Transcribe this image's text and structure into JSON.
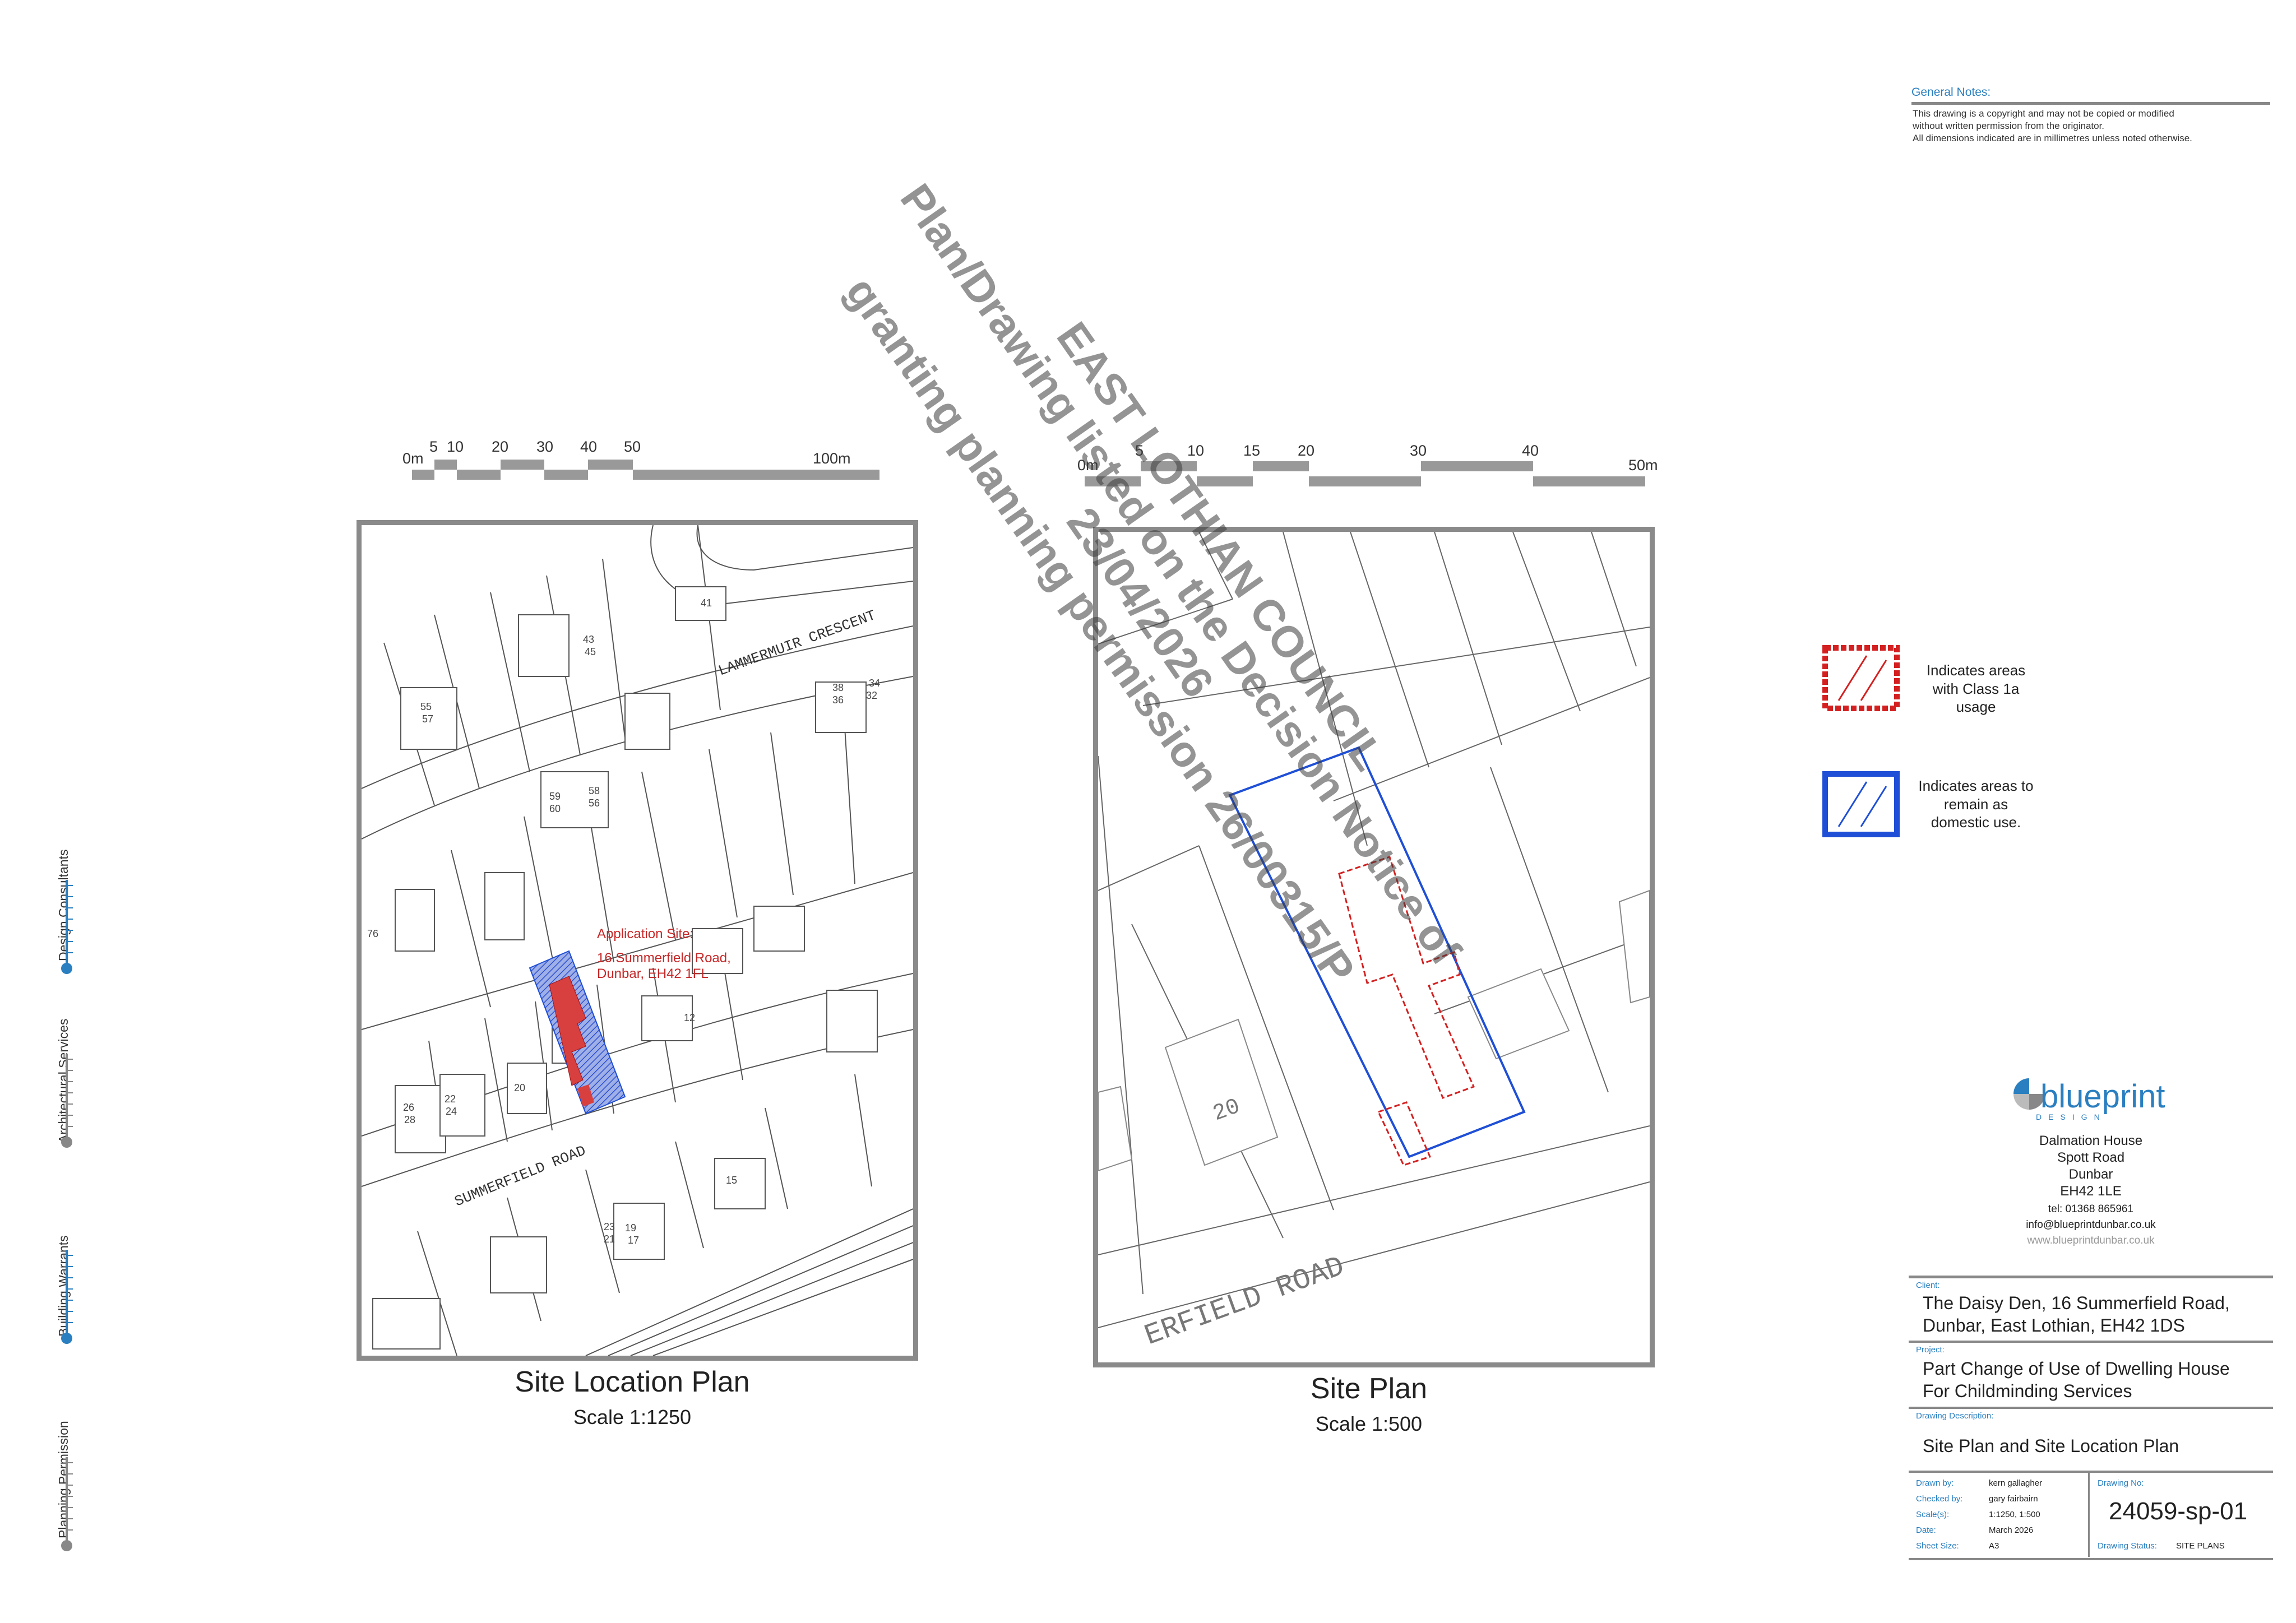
{
  "general_notes": {
    "title": "General Notes:",
    "lines": [
      "This drawing is a copyright and may not be copied or modified",
      "without written permission from the originator.",
      "All dimensions indicated are in millimetres unless noted otherwise."
    ]
  },
  "location_plan": {
    "title": "Site Location Plan",
    "scale": "Scale 1:1250",
    "scalebar_labels": [
      "0m",
      "5",
      "10",
      "20",
      "30",
      "40",
      "50",
      "100m"
    ],
    "application_site": {
      "heading": "Application Site:",
      "line1": "16 Summerfield Road,",
      "line2": "Dunbar, EH42 1FL"
    },
    "street_names": [
      "LAMMERMUIR CRESCENT",
      "SUMMERFIELD ROAD"
    ],
    "house_numbers": [
      "41",
      "43",
      "45",
      "55",
      "57",
      "34",
      "32",
      "38",
      "36",
      "58",
      "56",
      "59",
      "60",
      "76",
      "12",
      "20",
      "22",
      "24",
      "26",
      "28",
      "15",
      "19",
      "17",
      "23",
      "21"
    ]
  },
  "site_plan": {
    "title": "Site Plan",
    "scale": "Scale 1:500",
    "scalebar_labels": [
      "0m",
      "5",
      "10",
      "15",
      "20",
      "30",
      "40",
      "50m"
    ],
    "street_name": "ERFIELD ROAD",
    "house_number": "20"
  },
  "watermark": {
    "line1": "EAST LOTHIAN COUNCIL",
    "line2": "Plan/Drawing listed on the Decision Notice of",
    "line3": "23/04/2026",
    "line4": "granting planning permission 26/00315/P"
  },
  "legend": {
    "class1a": "Indicates areas with Class 1a usage",
    "domestic": "Indicates areas to remain as domestic use."
  },
  "side_services": [
    "Design Consultants",
    "Architectural Services",
    "Building Warrants",
    "Planning Permission"
  ],
  "company": {
    "name": "blueprint",
    "tagline": "DESIGN",
    "address": [
      "Dalmation House",
      "Spott Road",
      "Dunbar",
      "EH42 1LE"
    ],
    "tel": "tel: 01368 865961",
    "email": "info@blueprintdunbar.co.uk",
    "web": "www.blueprintdunbar.co.uk"
  },
  "title_block": {
    "client_label": "Client:",
    "client_line1": "The Daisy Den, 16 Summerfield Road,",
    "client_line2": "Dunbar, East Lothian, EH42 1DS",
    "project_label": "Project:",
    "project_line1": "Part Change of Use of Dwelling House",
    "project_line2": "For Childminding Services",
    "description_label": "Drawing Description:",
    "description": "Site Plan and Site Location Plan",
    "drawn_by_label": "Drawn by:",
    "drawn_by": "kern gallagher",
    "checked_by_label": "Checked by:",
    "checked_by": "gary fairbairn",
    "scales_label": "Scale(s):",
    "scales": "1:1250, 1:500",
    "date_label": "Date:",
    "date": "March 2026",
    "sheet_label": "Sheet Size:",
    "sheet": "A3",
    "drawing_no_label": "Drawing No:",
    "drawing_no": "24059-sp-01",
    "status_label": "Drawing Status:",
    "status": "SITE PLANS"
  },
  "colors": {
    "class1a_red": "#d42020",
    "domestic_blue": "#1f4fd6",
    "frame_grey": "#8a8a8a",
    "brand_blue": "#2a7fc0"
  }
}
